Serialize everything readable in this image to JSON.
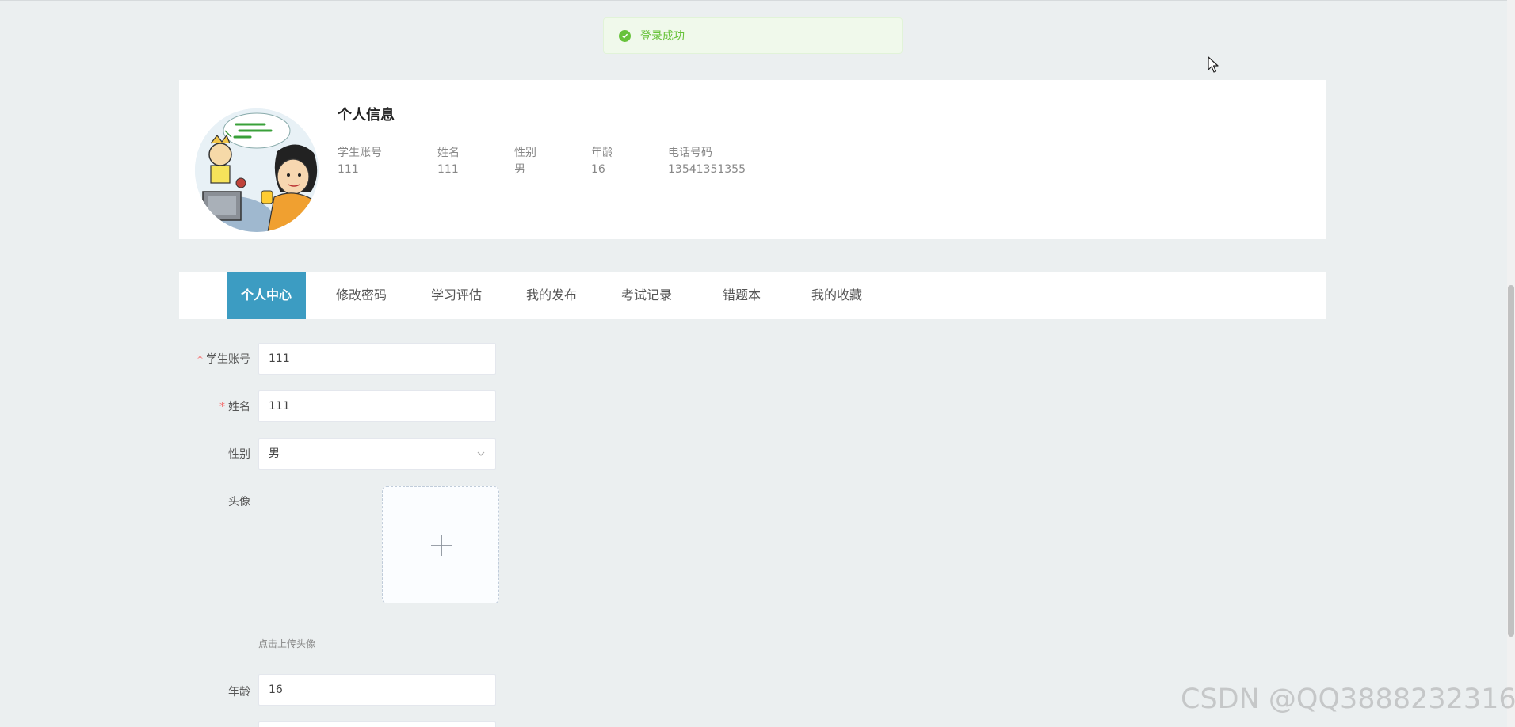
{
  "toast": {
    "message": "登录成功",
    "color": "#67c23a"
  },
  "profile": {
    "title": "个人信息",
    "fields": [
      {
        "label": "学生账号",
        "value": "111"
      },
      {
        "label": "姓名",
        "value": "111"
      },
      {
        "label": "性别",
        "value": "男"
      },
      {
        "label": "年龄",
        "value": "16"
      },
      {
        "label": "电话号码",
        "value": "13541351355"
      }
    ]
  },
  "tabs": [
    {
      "label": "个人中心",
      "active": true
    },
    {
      "label": "修改密码",
      "active": false
    },
    {
      "label": "学习评估",
      "active": false
    },
    {
      "label": "我的发布",
      "active": false
    },
    {
      "label": "考试记录",
      "active": false
    },
    {
      "label": "错题本",
      "active": false
    },
    {
      "label": "我的收藏",
      "active": false
    }
  ],
  "form": {
    "account": {
      "label": "学生账号",
      "required": "*",
      "value": "111"
    },
    "name": {
      "label": "姓名",
      "required": "*",
      "value": "111"
    },
    "gender": {
      "label": "性别",
      "value": "男"
    },
    "avatar": {
      "label": "头像",
      "hint": "点击上传头像"
    },
    "age": {
      "label": "年龄",
      "value": "16"
    }
  },
  "accent_color": "#3c9cc2",
  "watermark": "CSDN @QQ3888232316"
}
